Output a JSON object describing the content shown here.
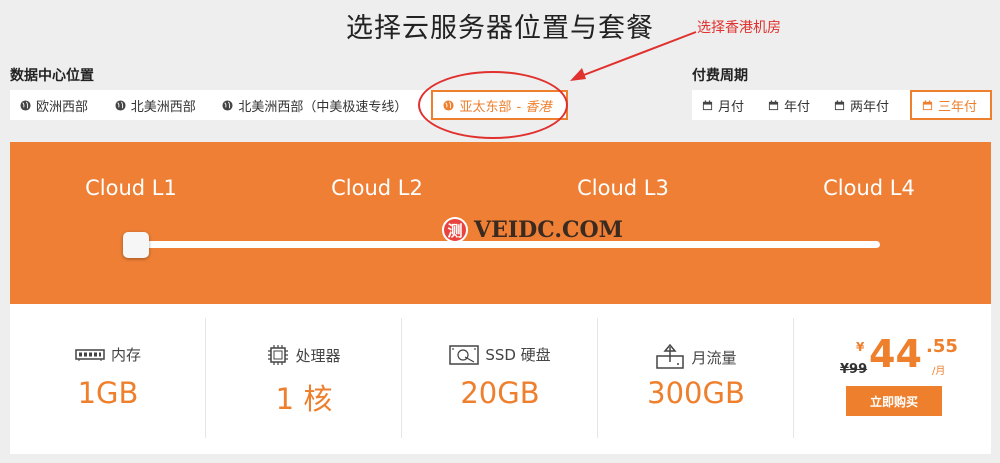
{
  "title": "选择云服务器位置与套餐",
  "annotation": {
    "text": "选择香港机房",
    "color": "#e0312f"
  },
  "datacenter": {
    "label": "数据中心位置",
    "options": [
      {
        "label": "欧洲西部",
        "active": false
      },
      {
        "label": "北美洲西部",
        "active": false
      },
      {
        "label": "北美洲西部（中美极速专线）",
        "active": false
      },
      {
        "label": "亚太东部",
        "suffix": "- 香港",
        "active": true
      }
    ]
  },
  "billing": {
    "label": "付费周期",
    "options": [
      {
        "label": "月付",
        "active": false
      },
      {
        "label": "年付",
        "active": false
      },
      {
        "label": "两年付",
        "active": false
      },
      {
        "label": "三年付",
        "active": true
      }
    ]
  },
  "plans": {
    "tiers": [
      "Cloud L1",
      "Cloud L2",
      "Cloud L3",
      "Cloud L4"
    ],
    "selected_index": 0
  },
  "watermark": {
    "badge": "测",
    "text": "VEIDC.COM"
  },
  "specs": [
    {
      "icon": "memory-icon",
      "label": "内存",
      "value": "1GB"
    },
    {
      "icon": "cpu-icon",
      "label": "处理器",
      "value": "1 核"
    },
    {
      "icon": "ssd-icon",
      "label": "SSD 硬盘",
      "value": "20GB"
    },
    {
      "icon": "upload-icon",
      "label": "月流量",
      "value": "300GB"
    }
  ],
  "price": {
    "currency": "¥",
    "old": "¥99",
    "integer": "44",
    "decimal": ".55",
    "unit": "/月",
    "buy_label": "立即购买"
  },
  "colors": {
    "accent": "#ee7f2d",
    "panel": "#ee7f35",
    "annotation": "#e0312f"
  }
}
